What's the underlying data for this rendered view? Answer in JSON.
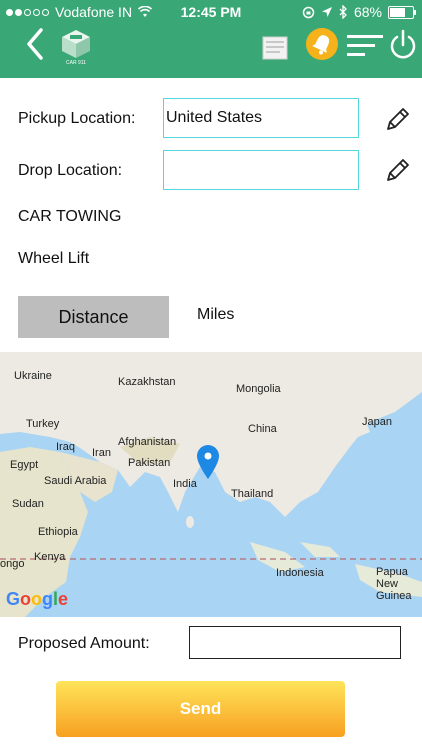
{
  "status_bar": {
    "carrier": "Vodafone IN",
    "time": "12:45 PM",
    "battery": "68%",
    "battery_level": 0.68
  },
  "header": {
    "logo_text": "CAR 911",
    "colors": {
      "bar": "#3aa876",
      "bell": "#f5b21a"
    }
  },
  "form": {
    "pickup_label": "Pickup Location:",
    "pickup_value": "United States",
    "drop_label": "Drop Location:",
    "drop_value": "",
    "service": "CAR TOWING",
    "tow_type": "Wheel Lift",
    "distance_button": "Distance",
    "distance_value": "Miles"
  },
  "map": {
    "labels": [
      "Ukraine",
      "Kazakhstan",
      "Mongolia",
      "Turkey",
      "Afghanistan",
      "China",
      "Iraq",
      "Iran",
      "Japan",
      "Pakistan",
      "Egypt",
      "Saudi Arabia",
      "India",
      "Thailand",
      "Sudan",
      "Ethiopia",
      "Kenya",
      "Indonesia",
      "Papua New Guinea",
      "ongo"
    ],
    "attribution": "Google"
  },
  "footer": {
    "amount_label": "Proposed Amount:",
    "amount_value": "",
    "send_label": "Send"
  }
}
